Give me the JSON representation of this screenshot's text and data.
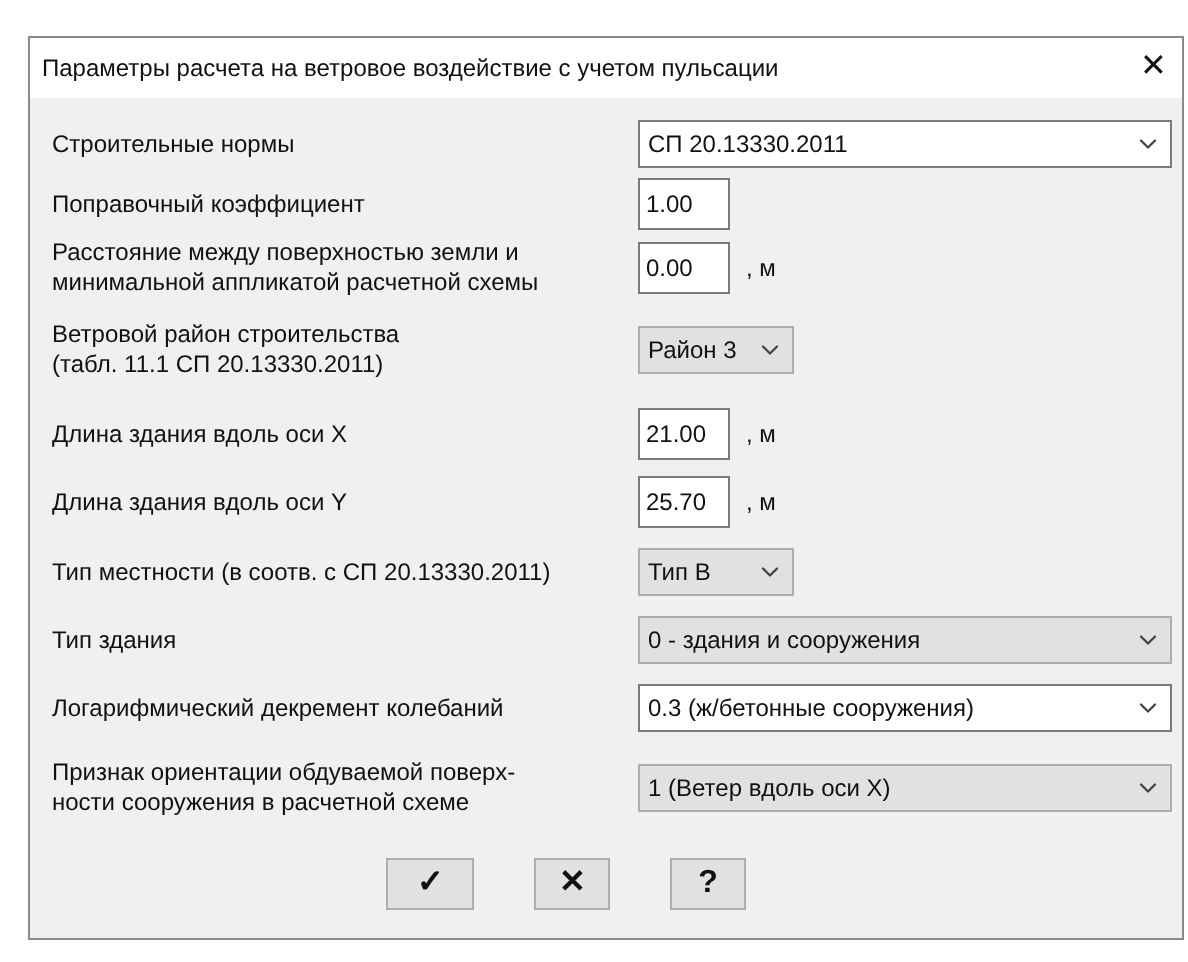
{
  "window": {
    "title": "Параметры расчета на ветровое воздействие с учетом пульсации",
    "close": "✕"
  },
  "rows": [
    {
      "lines": [
        "Строительные нормы"
      ],
      "kind": "text-combo",
      "value": "СП 20.13330.2011"
    },
    {
      "lines": [
        "Поправочный коэффициент"
      ],
      "kind": "number",
      "value": "1.00"
    },
    {
      "lines": [
        "Расстояние между поверхностью земли и",
        "минимальной аппликатой расчетной схемы"
      ],
      "kind": "number",
      "value": "0.00",
      "unit": ", м"
    },
    {
      "lines": [
        "Ветровой район строительства",
        "(табл. 11.1  СП 20.13330.2011)"
      ],
      "kind": "short-select",
      "value": "Район 3"
    },
    {
      "lines": [
        "Длина здания вдоль оси X"
      ],
      "kind": "number",
      "value": "21.00",
      "unit": ", м"
    },
    {
      "lines": [
        "Длина здания вдоль оси Y"
      ],
      "kind": "number",
      "value": "25.70",
      "unit": ", м"
    },
    {
      "lines": [
        "Тип местности (в соотв. с СП 20.13330.2011)"
      ],
      "kind": "short-select",
      "value": "Тип В"
    },
    {
      "lines": [
        "Тип здания"
      ],
      "kind": "select",
      "value": "0 - здания и сооружения"
    },
    {
      "lines": [
        "Логарифмический декремент колебаний"
      ],
      "kind": "text-combo",
      "value": "0.3 (ж/бетонные сооружения)"
    },
    {
      "lines": [
        "Признак ориентации обдуваемой поверх-",
        "ности сооружения в расчетной схеме"
      ],
      "kind": "select",
      "value": "1 (Ветер вдоль оси X)"
    }
  ],
  "buttons": [
    {
      "label": "✓",
      "kind": "ok"
    },
    {
      "label": "✕",
      "kind": "cancel"
    },
    {
      "label": "?",
      "kind": "help"
    }
  ]
}
